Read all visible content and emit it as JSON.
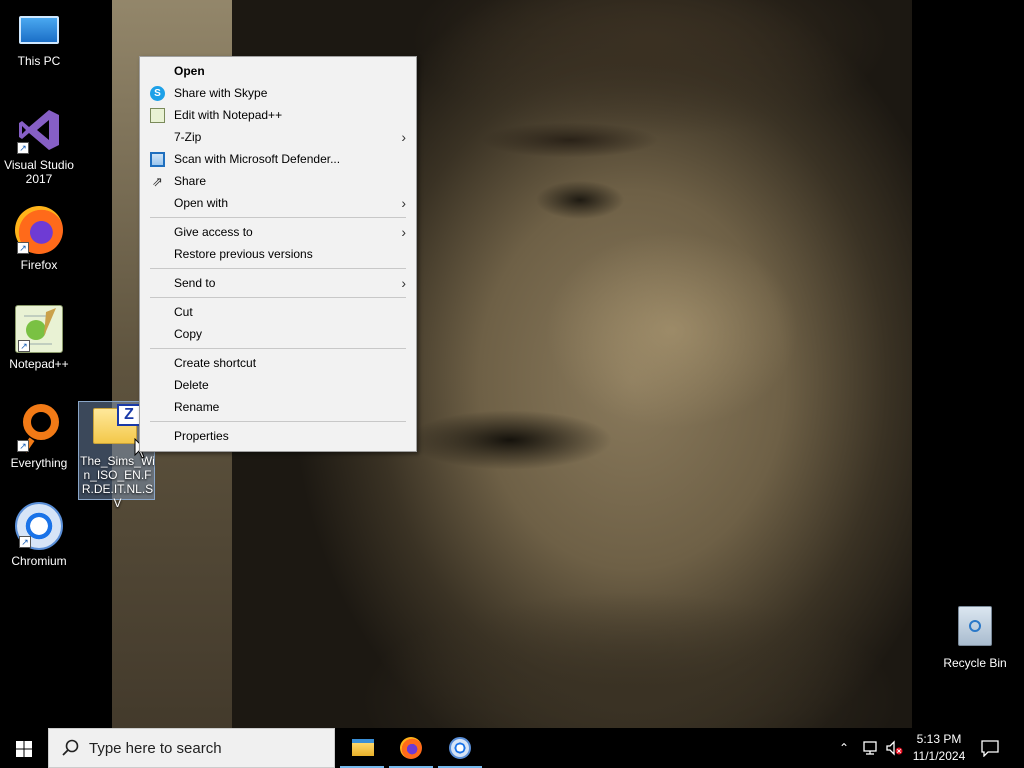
{
  "desktop": {
    "icons": [
      {
        "label": "This PC"
      },
      {
        "label": "Visual Studio 2017"
      },
      {
        "label": "Firefox"
      },
      {
        "label": "Notepad++"
      },
      {
        "label": "Everything"
      },
      {
        "label": "Chromium"
      },
      {
        "label": "Recycle Bin"
      }
    ],
    "selected_file": {
      "label": "The_Sims_Win_ISO_EN.FR.DE.IT.NL.SV",
      "icon_letter": "Z"
    }
  },
  "context_menu": {
    "items": [
      {
        "label": "Open"
      },
      {
        "label": "Share with Skype"
      },
      {
        "label": "Edit with Notepad++"
      },
      {
        "label": "7-Zip"
      },
      {
        "label": "Scan with Microsoft Defender..."
      },
      {
        "label": "Share"
      },
      {
        "label": "Open with"
      },
      {
        "label": "Give access to"
      },
      {
        "label": "Restore previous versions"
      },
      {
        "label": "Send to"
      },
      {
        "label": "Cut"
      },
      {
        "label": "Copy"
      },
      {
        "label": "Create shortcut"
      },
      {
        "label": "Delete"
      },
      {
        "label": "Rename"
      },
      {
        "label": "Properties"
      }
    ],
    "submenu_arrow": "›",
    "skype_glyph": "S",
    "share_glyph": "⇗"
  },
  "taskbar": {
    "search_placeholder": "Type here to search",
    "tray_chevron": "⌃",
    "clock_time": "5:13 PM",
    "clock_date": "11/1/2024"
  }
}
